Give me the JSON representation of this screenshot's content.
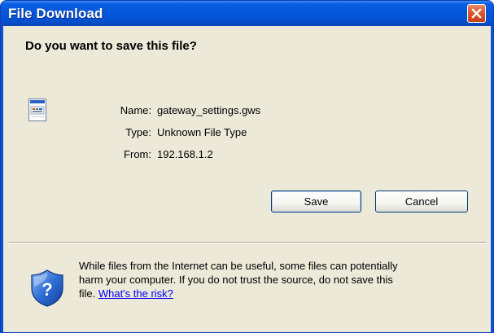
{
  "window": {
    "title": "File Download"
  },
  "dialog": {
    "question": "Do you want to save this file?",
    "fields": [
      {
        "label": "Name:",
        "value": "gateway_settings.gws"
      },
      {
        "label": "Type:",
        "value": "Unknown File Type"
      },
      {
        "label": "From:",
        "value": "192.168.1.2"
      }
    ],
    "buttons": {
      "save": "Save",
      "cancel": "Cancel"
    },
    "warning": {
      "line1": "While files from the Internet can be useful, some files can potentially",
      "line2": "harm your computer. If you do not trust the source, do not save this",
      "line3_prefix": "file. ",
      "link": "What's the risk?"
    }
  },
  "icons": {
    "close": "close-icon",
    "file": "file-icon",
    "shield": "shield-icon"
  },
  "colors": {
    "titlebar": "#0456d8",
    "client_bg": "#ece9d8",
    "close_button": "#d9572e",
    "link": "#0000ff"
  }
}
